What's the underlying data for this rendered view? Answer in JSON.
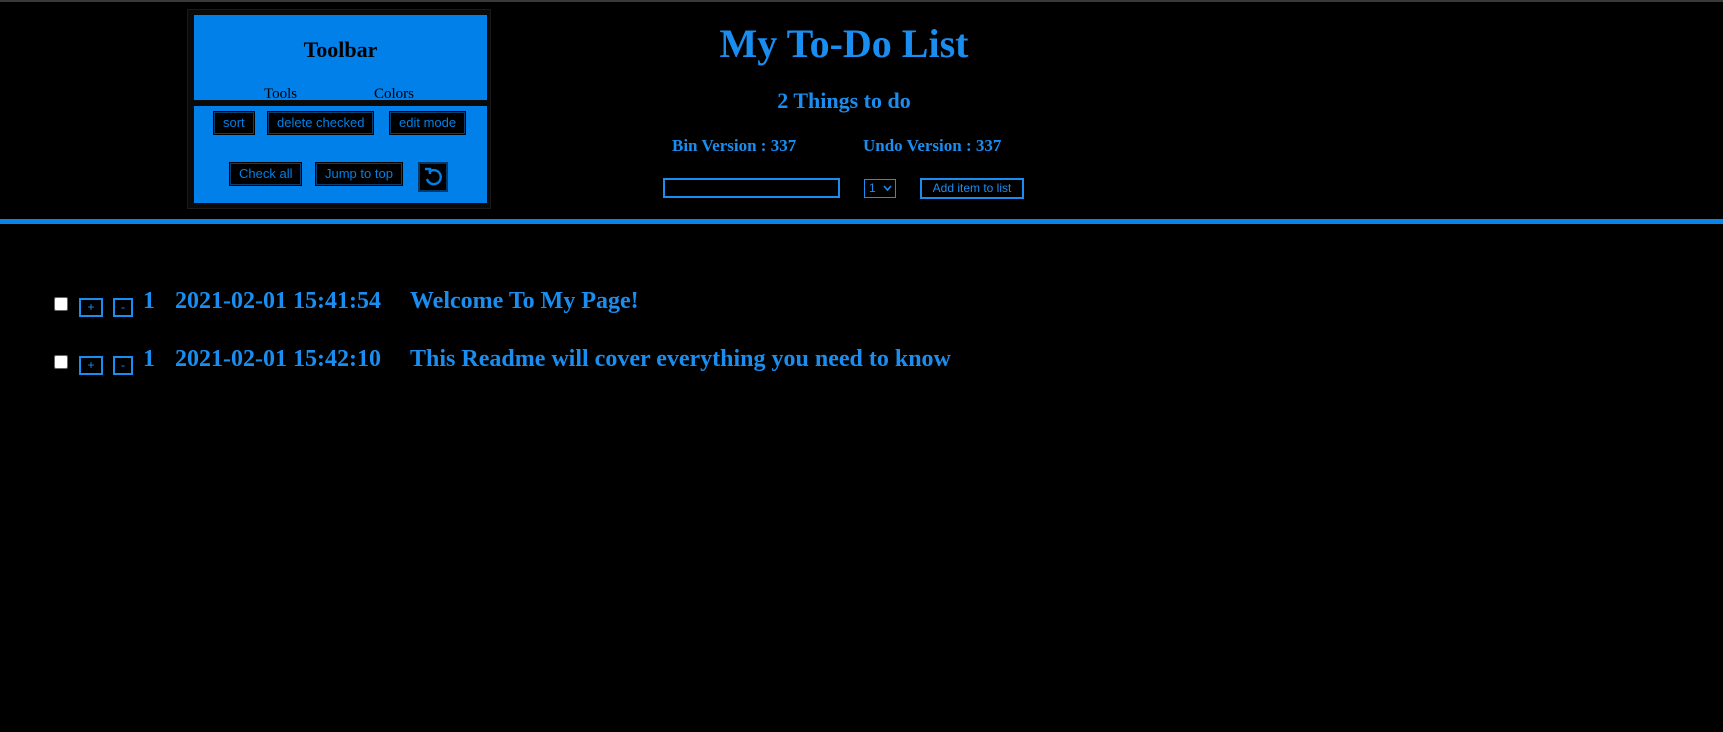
{
  "toolbar": {
    "title": "Toolbar",
    "tabs": [
      "Tools",
      "Colors"
    ],
    "buttons": {
      "sort": "sort",
      "delete_checked": "delete checked",
      "edit_mode": "edit mode",
      "check_all": "Check all",
      "jump_to_top": "Jump to top"
    },
    "undo_icon": "undo-icon"
  },
  "header": {
    "title": "My To-Do List",
    "subtitle": "2 Things to do",
    "bin_version": "Bin Version : 337",
    "undo_version": "Undo Version : 337",
    "input_value": "",
    "priority_selected": "1",
    "add_button": "Add item to list"
  },
  "todos": [
    {
      "checked": false,
      "plus": "+",
      "minus": "-",
      "priority": "1",
      "timestamp": "2021-02-01 15:41:54",
      "text": "Welcome To My Page!"
    },
    {
      "checked": false,
      "plus": "+",
      "minus": "-",
      "priority": "1",
      "timestamp": "2021-02-01 15:42:10",
      "text": "This Readme will cover everything you need to know"
    }
  ],
  "colors": {
    "accent": "#0080e8",
    "text": "#1a8ef0",
    "background": "#000000"
  }
}
